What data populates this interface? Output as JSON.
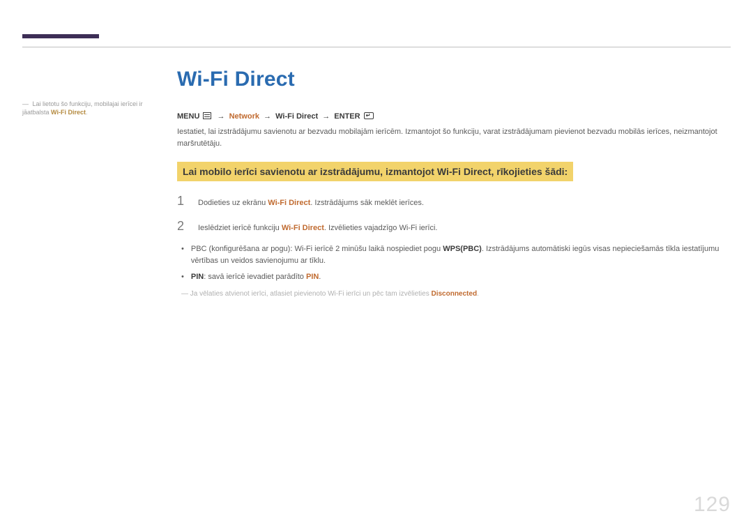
{
  "sidebar": {
    "note_prefix": "―",
    "note_text_a": "Lai lietotu šo funkciju, mobilajai ierīcei ir jāatbalsta ",
    "note_em": "Wi-Fi Direct",
    "note_text_b": "."
  },
  "main": {
    "title": "Wi-Fi Direct",
    "breadcrumb": {
      "menu": "MENU",
      "network": "Network",
      "wifidirect": "Wi-Fi Direct",
      "enter": "ENTER"
    },
    "intro": "Iestatiet, lai izstrādājumu savienotu ar bezvadu mobilajām ierīcēm. Izmantojot šo funkciju, varat izstrādājumam pievienot bezvadu mobilās ierīces, neizmantojot maršrutētāju.",
    "highlight": "Lai mobilo ierīci savienotu ar izstrādājumu, izmantojot Wi-Fi Direct, rīkojieties šādi:",
    "steps": [
      {
        "num": "1",
        "pre": "Dodieties uz ekrānu ",
        "em": "Wi-Fi Direct",
        "post": ". Izstrādājums sāk meklēt ierīces."
      },
      {
        "num": "2",
        "pre": "Ieslēdziet ierīcē funkciju ",
        "em": "Wi-Fi Direct",
        "post": ". Izvēlieties vajadzīgo Wi-Fi ierīci."
      }
    ],
    "bullets": [
      {
        "pre": "PBC (konfigurēšana ar pogu): Wi-Fi ierīcē 2 minūšu laikā nospiediet pogu ",
        "bold": "WPS(PBC)",
        "post": ". Izstrādājums automātiski iegūs visas nepieciešamās tīkla iestatījumu vērtības un veidos savienojumu ar tīklu."
      },
      {
        "bold_lead": "PIN",
        "pre": ": savā ierīcē ievadiet parādīto ",
        "em": "PIN",
        "post": "."
      }
    ],
    "footnote": {
      "dash": "―",
      "pre": "Ja vēlaties atvienot ierīci, atlasiet pievienoto Wi-Fi ierīci un pēc tam izvēlieties ",
      "em": "Disconnected",
      "post": "."
    }
  },
  "page_number": "129"
}
